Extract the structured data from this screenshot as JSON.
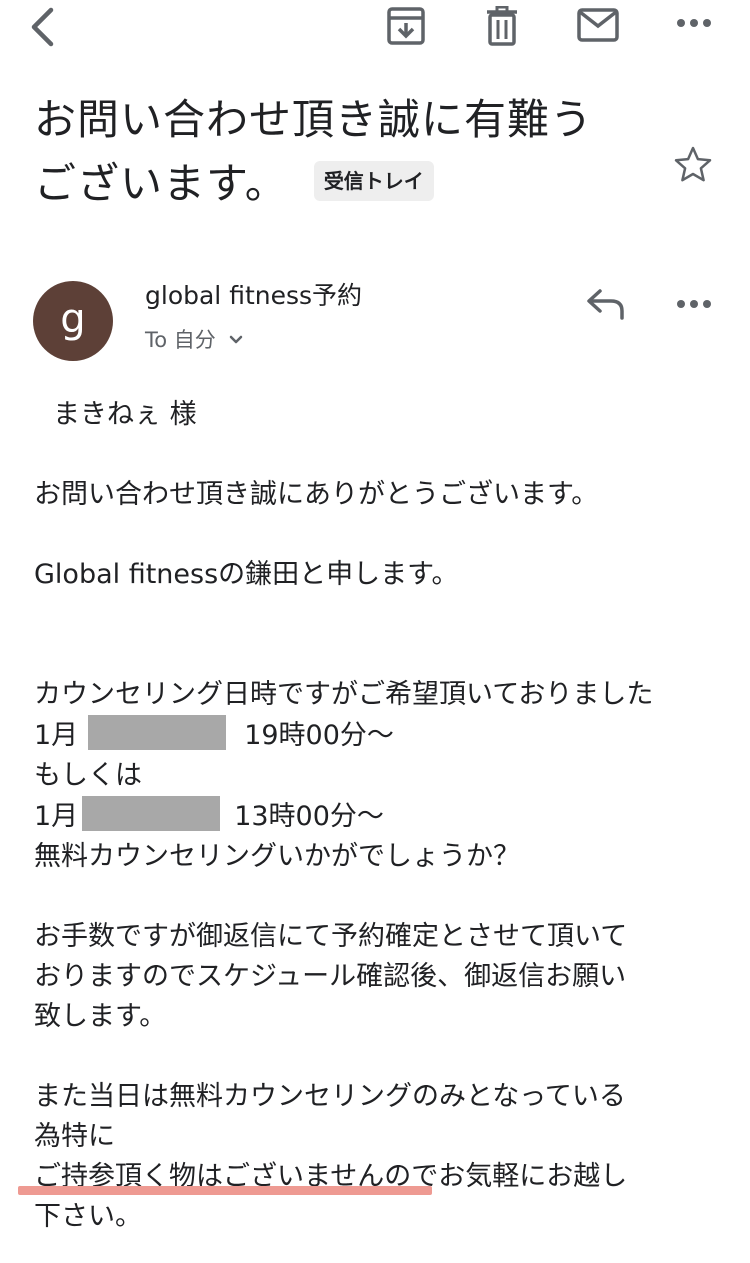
{
  "subject": {
    "line1": "お問い合わせ頂き誠に有難う",
    "line2": "ございます。",
    "label": "受信トレイ"
  },
  "sender": {
    "avatar_letter": "g",
    "name": "global fitness予約",
    "to": "To 自分"
  },
  "body": {
    "greeting": "まきねぇ 様",
    "line_thanks": "お問い合わせ頂き誠にありがとうございます。",
    "line_intro": "Global fitnessの鎌田と申します。",
    "line_counsel": "カウンセリング日時ですがご希望頂いておりました",
    "date1_prefix": "1月",
    "date1_time": "19時00分〜",
    "or": "もしくは",
    "date2_prefix": "1月",
    "date2_time": "13時00分〜",
    "line_question": "無料カウンセリングいかがでしょうか？",
    "line_reply_1": "お手数ですが御返信にて予約確定とさせて頂いて",
    "line_reply_2": "おりますのでスケジュール確認後、御返信お願い",
    "line_reply_3": "致します。",
    "line_day_1": "また当日は無料カウンセリングのみとなっている",
    "line_day_2": "為特に",
    "line_day_3": "ご持参頂く物はございませんのでお気軽にお越し",
    "line_day_4": "下さい。"
  },
  "icons": {
    "back": "chevron-left-icon",
    "archive": "archive-icon",
    "delete": "trash-icon",
    "mark_unread": "mail-icon",
    "more": "more-horizontal-icon",
    "star": "star-icon",
    "reply": "reply-icon",
    "expand": "chevron-down-icon"
  },
  "colors": {
    "avatar": "#5d4037",
    "redaction": "#a8a8a8",
    "highlight_underline": "#ee9a92",
    "icon": "#5f6368"
  }
}
